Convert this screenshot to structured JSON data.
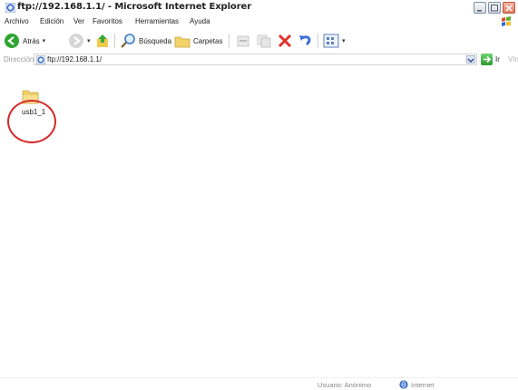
{
  "window": {
    "title": "ftp://192.168.1.1/ - Microsoft Internet Explorer"
  },
  "menu": [
    "Archivo",
    "Edición",
    "Ver",
    "Favoritos",
    "Herramientas",
    "Ayuda"
  ],
  "toolbar": {
    "back_label": "Atrás",
    "search_label": "Búsqueda",
    "folders_label": "Carpetas"
  },
  "address": {
    "label": "Dirección",
    "url": "ftp://192.168.1.1/",
    "go_label": "Ir",
    "links_label": "Vínculo"
  },
  "content": {
    "items": [
      {
        "name": "usb1_1",
        "icon": "folder-icon"
      }
    ]
  },
  "status": {
    "user_text": "Usuario: Anónimo",
    "zone_text": "Internet"
  },
  "colors": {
    "highlight_circle": "#d52a2a",
    "folder": "#f3d36a",
    "go_button": "#3aa83a"
  }
}
